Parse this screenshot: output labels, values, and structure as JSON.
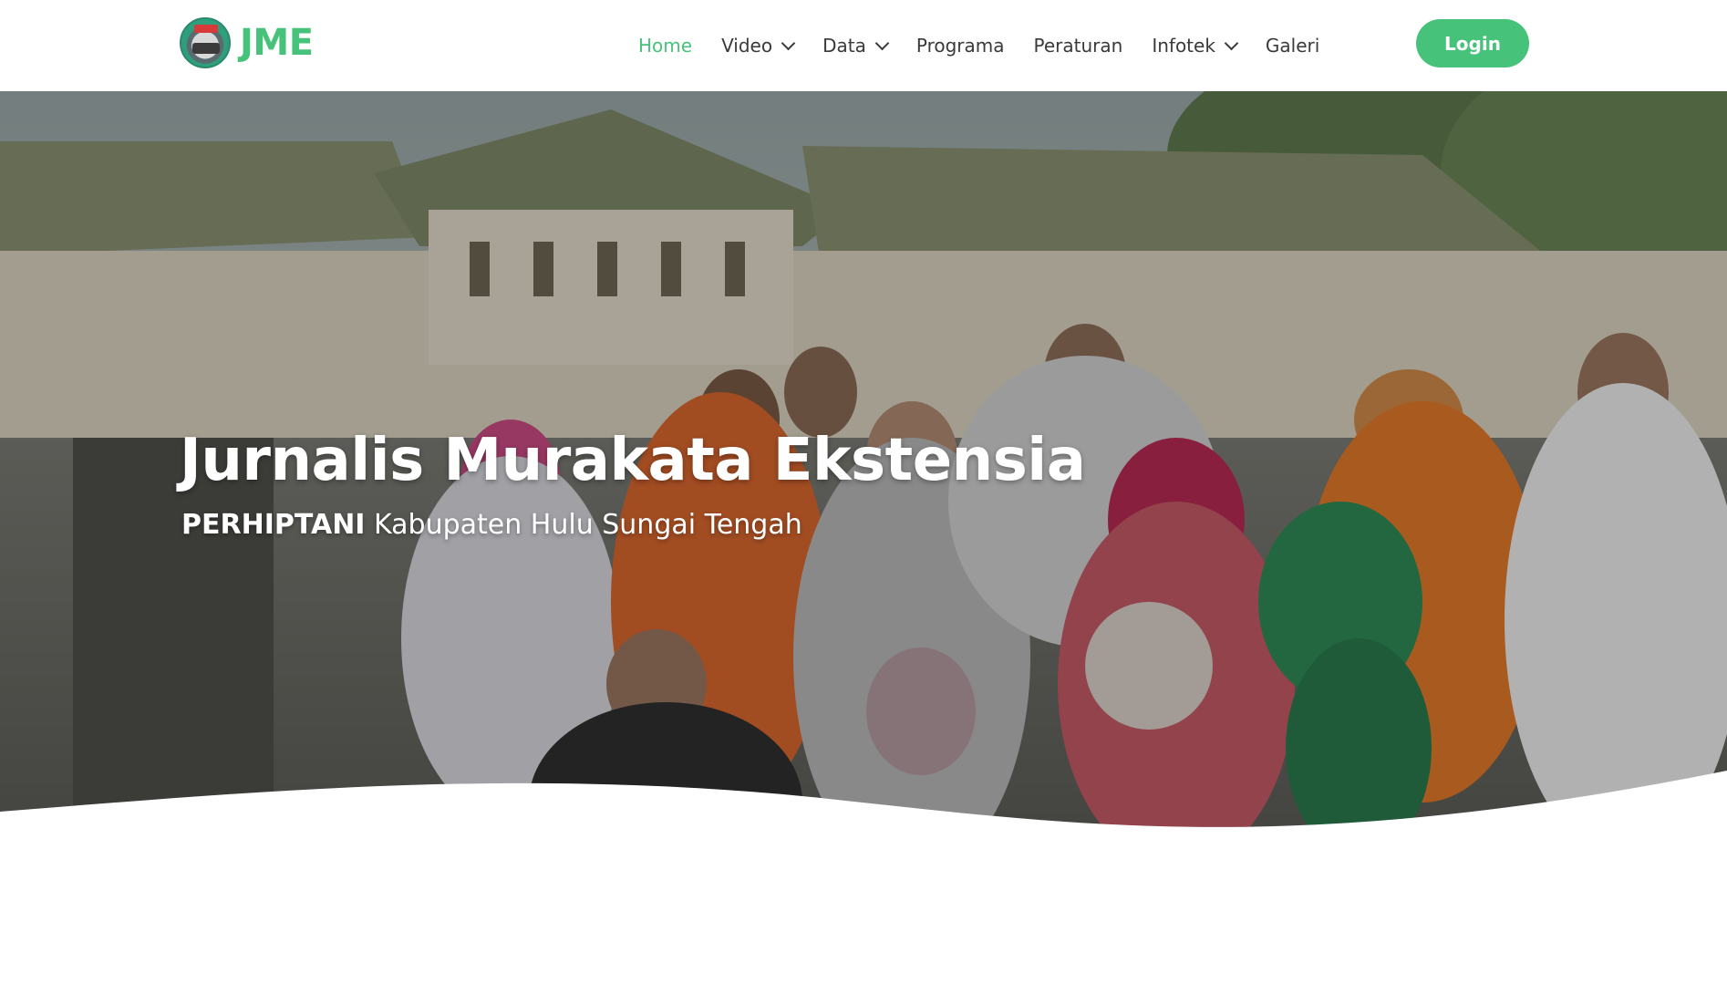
{
  "header": {
    "brand_name": "JME",
    "nav": [
      {
        "label": "Home",
        "active": true,
        "dropdown": false
      },
      {
        "label": "Video",
        "active": false,
        "dropdown": true
      },
      {
        "label": "Data",
        "active": false,
        "dropdown": true
      },
      {
        "label": "Programa",
        "active": false,
        "dropdown": false
      },
      {
        "label": "Peraturan",
        "active": false,
        "dropdown": false
      },
      {
        "label": "Infotek",
        "active": false,
        "dropdown": true
      },
      {
        "label": "Galeri",
        "active": false,
        "dropdown": false
      }
    ],
    "login_label": "Login"
  },
  "hero": {
    "title": "Jurnalis Murakata Ekstensia",
    "subtitle_bold": "PERHIPTANI",
    "subtitle_rest": " Kabupaten Hulu Sungai Tengah"
  },
  "colors": {
    "accent": "#47c27a",
    "nav_text": "#3a3a3a",
    "hero_text": "#ffffff"
  },
  "icons": {
    "dropdown": "chevron-down-icon",
    "logo": "jme-logo"
  }
}
